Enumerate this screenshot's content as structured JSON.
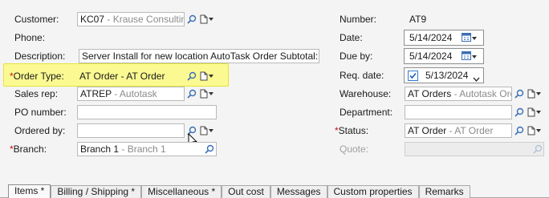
{
  "left": {
    "customer": {
      "label": "Customer:",
      "code": "KC07",
      "name": " - Krause Consulting, LLC"
    },
    "phone": {
      "label": "Phone:"
    },
    "description": {
      "label": "Description:",
      "value": "Server Install for new location AutoTask Order Subtotal:"
    },
    "order_type": {
      "required": "*",
      "label": "Order Type:",
      "code": "AT Order",
      "name": " - AT Order"
    },
    "sales_rep": {
      "label": "Sales rep:",
      "code": "ATREP",
      "name": " - Autotask"
    },
    "po_number": {
      "label": "PO number:",
      "value": ""
    },
    "ordered_by": {
      "label": "Ordered by:",
      "value": ""
    },
    "branch": {
      "required": "*",
      "label": "Branch:",
      "code": "Branch 1",
      "name": " - Branch 1"
    }
  },
  "right": {
    "number": {
      "label": "Number:",
      "value": "AT9"
    },
    "date": {
      "label": "Date:",
      "value": "5/14/2024"
    },
    "due_by": {
      "label": "Due by:",
      "value": "5/14/2024"
    },
    "req_date": {
      "label": "Req. date:",
      "value": "5/13/2024",
      "checked": true
    },
    "warehouse": {
      "label": "Warehouse:",
      "code": "AT Orders",
      "name": " - Autotask Order"
    },
    "department": {
      "label": "Department:",
      "value": ""
    },
    "status": {
      "required": "*",
      "label": "Status:",
      "code": "AT Order",
      "name": " - AT Order"
    },
    "quote": {
      "label": "Quote:",
      "value": ""
    }
  },
  "tabs": [
    {
      "label": "Items *",
      "active": true
    },
    {
      "label": "Billing / Shipping *",
      "active": false
    },
    {
      "label": "Miscellaneous *",
      "active": false
    },
    {
      "label": "Out cost",
      "active": false
    },
    {
      "label": "Messages",
      "active": false
    },
    {
      "label": "Custom properties",
      "active": false
    },
    {
      "label": "Remarks",
      "active": false
    }
  ],
  "colors": {
    "highlight": "#fbfa92",
    "required": "#cc1111",
    "subtext": "#8a8a8a"
  },
  "icons": [
    "search-icon",
    "document-icon",
    "dropdown-arrow-icon",
    "calendar-icon",
    "checkbox-icon",
    "mouse-cursor-icon"
  ]
}
